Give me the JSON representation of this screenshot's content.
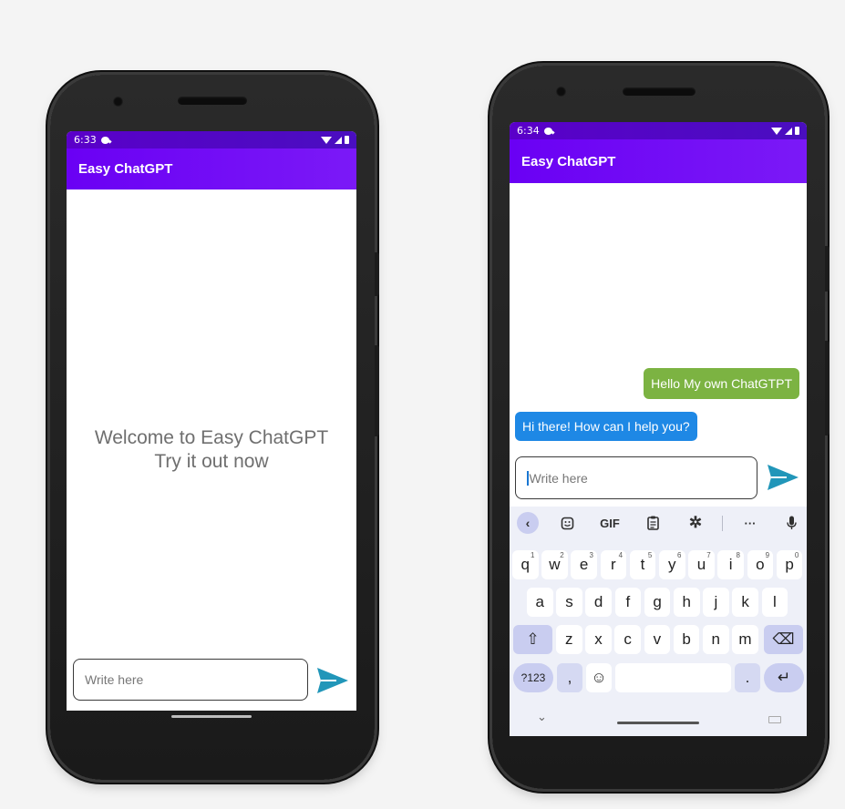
{
  "phone_left": {
    "status_time": "6:33",
    "app_title": "Easy ChatGPT",
    "welcome_line1": "Welcome to Easy ChatGPT",
    "welcome_line2": "Try it out now",
    "input_placeholder": "Write here"
  },
  "phone_right": {
    "status_time": "6:34",
    "app_title": "Easy ChatGPT",
    "messages": [
      {
        "role": "user",
        "text": "Hello My own ChatGTPT"
      },
      {
        "role": "bot",
        "text": "Hi there! How can I help you?"
      }
    ],
    "input_placeholder": "Write here",
    "keyboard": {
      "toolbar": [
        "back-icon",
        "sticker-icon",
        "GIF",
        "clipboard-icon",
        "settings-icon",
        "more-icon",
        "mic-icon"
      ],
      "gif_label": "GIF",
      "more_label": "···",
      "row1": [
        {
          "k": "q",
          "h": "1"
        },
        {
          "k": "w",
          "h": "2"
        },
        {
          "k": "e",
          "h": "3"
        },
        {
          "k": "r",
          "h": "4"
        },
        {
          "k": "t",
          "h": "5"
        },
        {
          "k": "y",
          "h": "6"
        },
        {
          "k": "u",
          "h": "7"
        },
        {
          "k": "i",
          "h": "8"
        },
        {
          "k": "o",
          "h": "9"
        },
        {
          "k": "p",
          "h": "0"
        }
      ],
      "row2": [
        "a",
        "s",
        "d",
        "f",
        "g",
        "h",
        "j",
        "k",
        "l"
      ],
      "row3": [
        "z",
        "x",
        "c",
        "v",
        "b",
        "n",
        "m"
      ],
      "sym_label": "?123",
      "comma_label": ",",
      "period_label": ".",
      "shift_glyph": "⇧",
      "backspace_glyph": "⌫",
      "enter_glyph": "↵",
      "emoji_glyph": "☺",
      "collapse_glyph": "⌄"
    }
  },
  "colors": {
    "app_bar": "#6a00f4",
    "status_bar": "#4a0ec0",
    "user_bubble": "#7cb342",
    "bot_bubble": "#1e88e5",
    "send_icon": "#2196b9"
  }
}
